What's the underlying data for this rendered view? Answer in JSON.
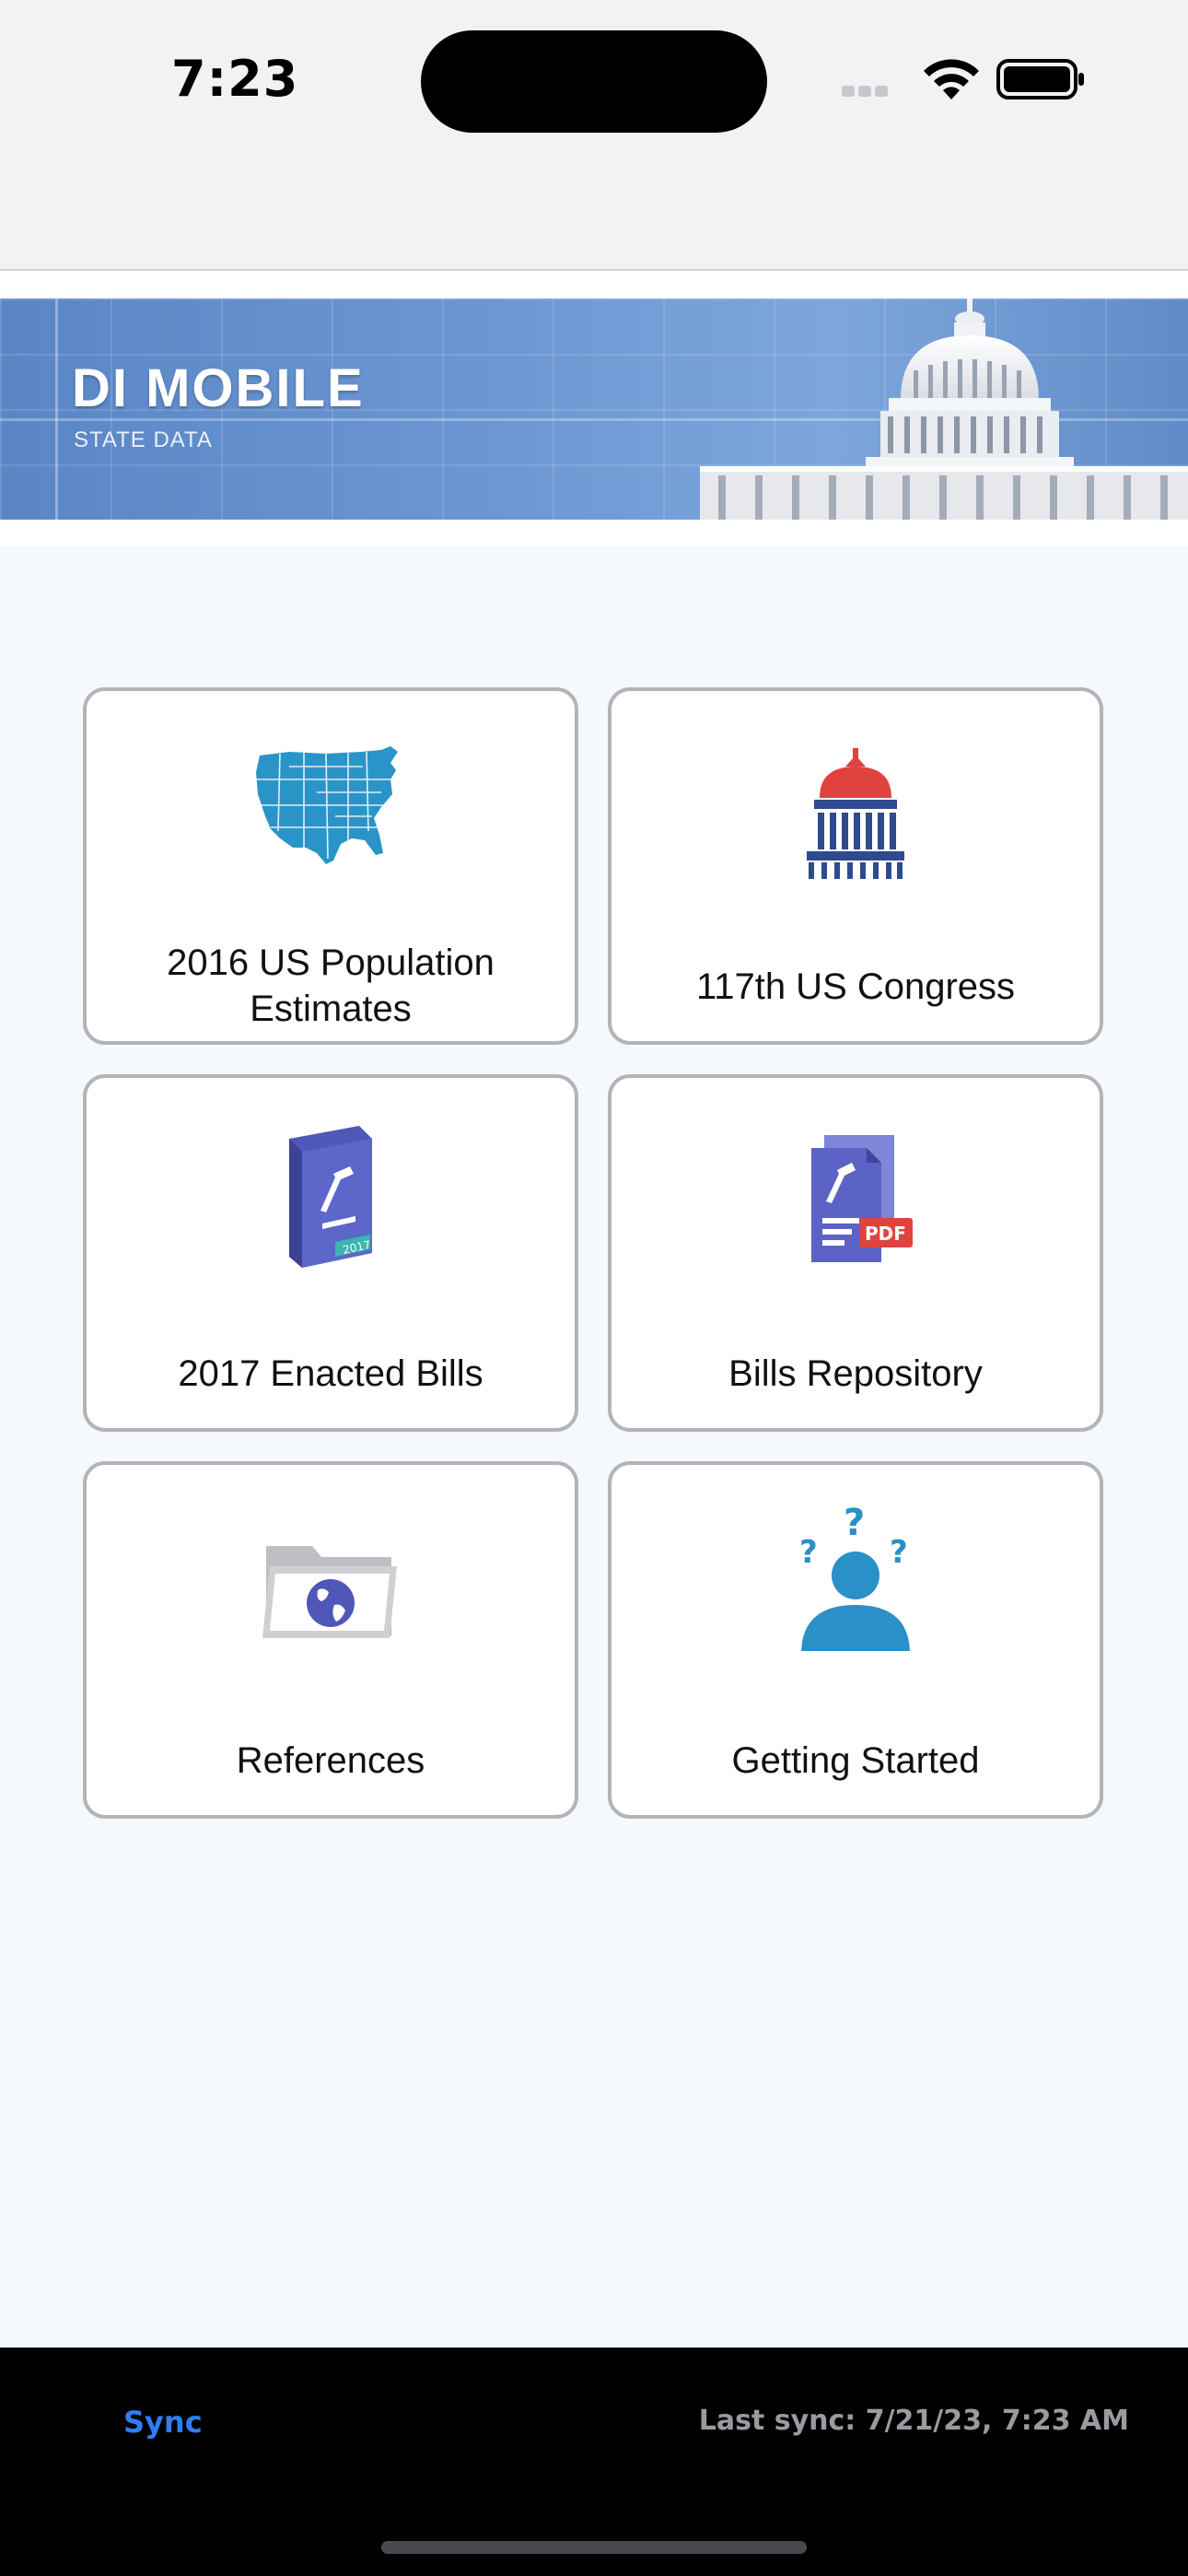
{
  "status_bar": {
    "time": "7:23"
  },
  "banner": {
    "title": "DI MOBILE",
    "subtitle": "STATE DATA"
  },
  "tiles": [
    {
      "label": "2016 US Population Estimates",
      "icon": "us-map-icon"
    },
    {
      "label": "117th US Congress",
      "icon": "capitol-dome-icon"
    },
    {
      "label": "2017 Enacted Bills",
      "icon": "law-book-icon"
    },
    {
      "label": "Bills Repository",
      "icon": "pdf-document-icon"
    },
    {
      "label": "References",
      "icon": "globe-folder-icon"
    },
    {
      "label": "Getting Started",
      "icon": "person-question-icon"
    }
  ],
  "toolbar": {
    "sync_label": "Sync",
    "last_sync": "Last sync: 7/21/23, 7:23 AM"
  },
  "colors": {
    "accent": "#2f7df6",
    "banner": "#6b96d2",
    "toolbar": "#000000"
  }
}
